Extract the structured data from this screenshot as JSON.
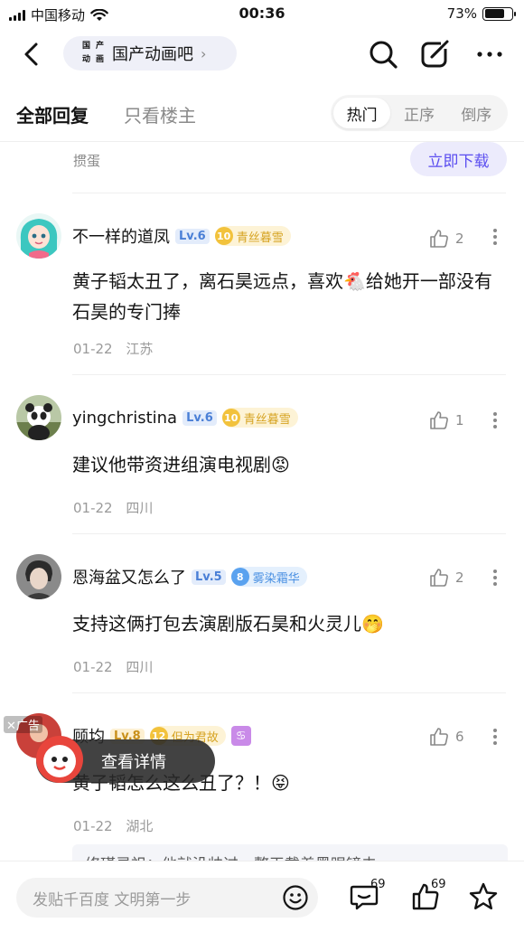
{
  "status": {
    "carrier": "中国移动",
    "time": "00:36",
    "battery": "73%",
    "battery_level": 0.73
  },
  "nav": {
    "forum_name": "国产动画吧",
    "forum_logo": [
      "国",
      "产",
      "动",
      "画"
    ]
  },
  "tabs": {
    "all": "全部回复",
    "op_only": "只看楼主",
    "sort": [
      "热门",
      "正序",
      "倒序"
    ],
    "active_sort": "热门"
  },
  "ad_strip": {
    "source": "掼蛋",
    "download_label": "立即下载"
  },
  "comments": [
    {
      "user": "不一样的道凤",
      "level": "Lv.6",
      "badge_num": "10",
      "badge_name": "青丝暮雪",
      "likes": "2",
      "text": "黄子韬太丑了，离石昊远点，喜欢🐔给她开一部没有石昊的专门捧",
      "date": "01-22",
      "location": "江苏"
    },
    {
      "user": "yingchristina",
      "level": "Lv.6",
      "badge_num": "10",
      "badge_name": "青丝暮雪",
      "likes": "1",
      "text": "建议他带资进组演电视剧😡",
      "date": "01-22",
      "location": "四川"
    },
    {
      "user": "恩海盆又怎么了",
      "level": "Lv.5",
      "badge_num": "8",
      "badge_name": "雾染霜华",
      "likes": "2",
      "text": "支持这俩打包去演剧版石昊和火灵儿🤭",
      "date": "01-22",
      "location": "四川"
    },
    {
      "user": "顾均",
      "level": "Lv.8",
      "badge_num": "12",
      "badge_name": "但为君故",
      "constellation": "♋",
      "likes": "6",
      "text": "黄子韬怎么这么丑了？！😝",
      "date": "01-22",
      "location": "湖北"
    }
  ],
  "float_ad": {
    "tag": "广告",
    "label": "查看详情"
  },
  "quote_preview": "修瑾灵祖：他就没帅过，整天戴着黑眼镜去",
  "bottom": {
    "input_placeholder": "发贴千百度 文明第一步",
    "comment_count": "69",
    "like_count": "69"
  }
}
